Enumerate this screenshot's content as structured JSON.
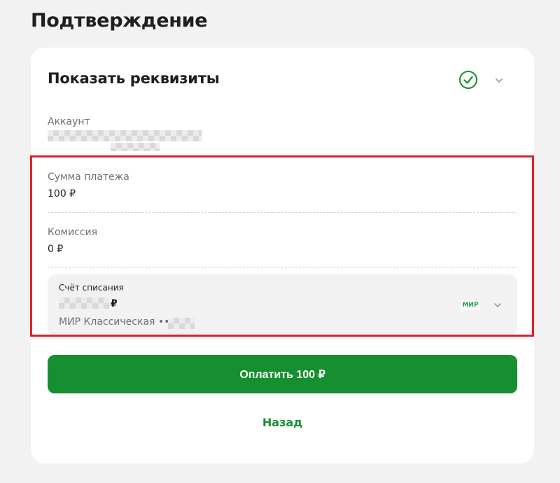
{
  "page": {
    "title": "Подтверждение"
  },
  "details": {
    "title": "Показать реквизиты",
    "status_icon": "check-circle-icon",
    "expand_icon": "chevron-down-icon",
    "account_label": "Аккаунт",
    "amount_label": "Сумма платежа",
    "amount_value": "100 ₽",
    "commission_label": "Комиссия",
    "commission_value": "0 ₽"
  },
  "debit": {
    "label": "Счёт списания",
    "amount_currency": "₽",
    "card_name": "МИР Классическая ••",
    "card_logo": "МИР",
    "expand_icon": "chevron-down-icon"
  },
  "actions": {
    "pay_label": "Оплатить 100 ₽",
    "back_label": "Назад"
  },
  "colors": {
    "accent": "#168f30",
    "highlight": "#e0202a",
    "background": "#f2f2f2"
  }
}
